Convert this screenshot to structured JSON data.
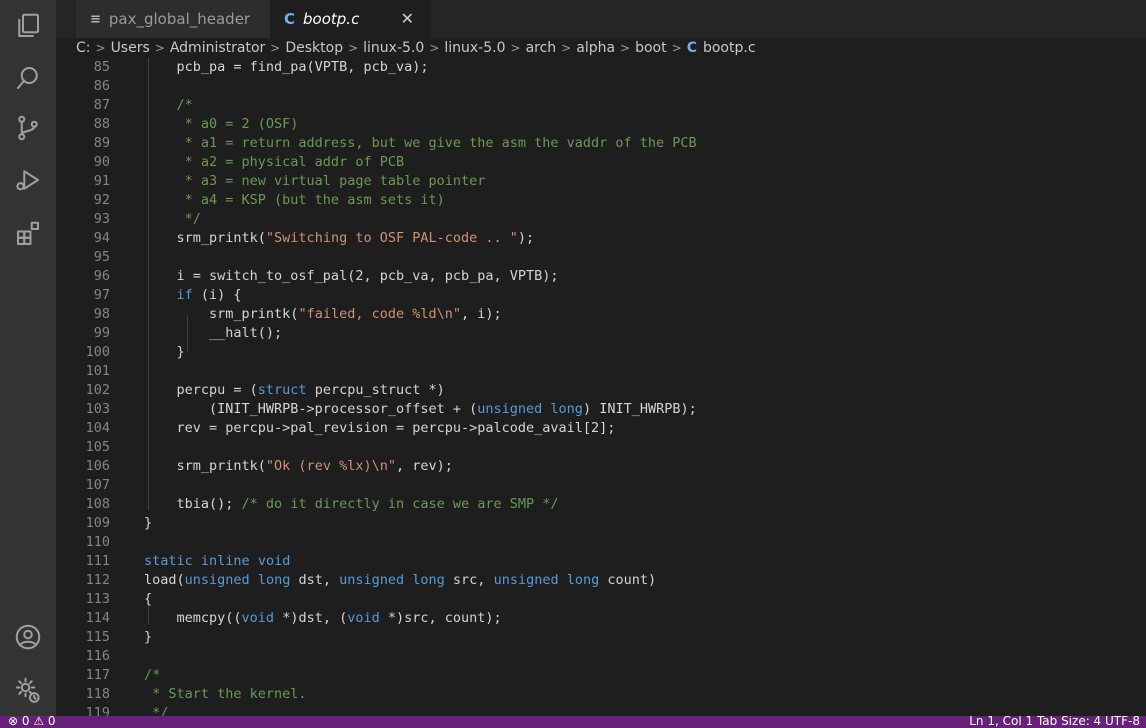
{
  "tabs": [
    {
      "label": "pax_global_header",
      "icon": "lines-icon"
    },
    {
      "label": "bootp.c",
      "icon": "c-icon",
      "close": "✕"
    }
  ],
  "breadcrumb": [
    "C:",
    "Users",
    "Administrator",
    "Desktop",
    "linux-5.0",
    "linux-5.0",
    "arch",
    "alpha",
    "boot",
    "bootp.c"
  ],
  "status": {
    "left": "⊗ 0 ⚠ 0",
    "right": "Ln 1, Col 1   Tab Size: 4   UTF-8"
  },
  "colors": {
    "accent_status": "#68217a",
    "keyword": "#569cd6",
    "string": "#ce9178",
    "comment": "#6a9955"
  },
  "lines": [
    {
      "n": "85",
      "t": "    pcb_pa = find_pa(VPTB, pcb_va);"
    },
    {
      "n": "86",
      "t": ""
    },
    {
      "n": "87",
      "t": "    /*"
    },
    {
      "n": "88",
      "t": "     * a0 = 2 (OSF)"
    },
    {
      "n": "89",
      "t": "     * a1 = return address, but we give the asm the vaddr of the PCB"
    },
    {
      "n": "90",
      "t": "     * a2 = physical addr of PCB"
    },
    {
      "n": "91",
      "t": "     * a3 = new virtual page table pointer"
    },
    {
      "n": "92",
      "t": "     * a4 = KSP (but the asm sets it)"
    },
    {
      "n": "93",
      "t": "     */"
    },
    {
      "n": "94",
      "t": "    srm_printk(\"Switching to OSF PAL-code .. \");"
    },
    {
      "n": "95",
      "t": ""
    },
    {
      "n": "96",
      "t": "    i = switch_to_osf_pal(2, pcb_va, pcb_pa, VPTB);"
    },
    {
      "n": "97",
      "t": "    if (i) {"
    },
    {
      "n": "98",
      "t": "        srm_printk(\"failed, code %ld\\n\", i);"
    },
    {
      "n": "99",
      "t": "        __halt();"
    },
    {
      "n": "100",
      "t": "    }"
    },
    {
      "n": "101",
      "t": ""
    },
    {
      "n": "102",
      "t": "    percpu = (struct percpu_struct *)"
    },
    {
      "n": "103",
      "t": "        (INIT_HWRPB->processor_offset + (unsigned long) INIT_HWRPB);"
    },
    {
      "n": "104",
      "t": "    rev = percpu->pal_revision = percpu->palcode_avail[2];"
    },
    {
      "n": "105",
      "t": ""
    },
    {
      "n": "106",
      "t": "    srm_printk(\"Ok (rev %lx)\\n\", rev);"
    },
    {
      "n": "107",
      "t": ""
    },
    {
      "n": "108",
      "t": "    tbia(); /* do it directly in case we are SMP */"
    },
    {
      "n": "109",
      "t": "}"
    },
    {
      "n": "110",
      "t": ""
    },
    {
      "n": "111",
      "t": "static inline void"
    },
    {
      "n": "112",
      "t": "load(unsigned long dst, unsigned long src, unsigned long count)"
    },
    {
      "n": "113",
      "t": "{"
    },
    {
      "n": "114",
      "t": "    memcpy((void *)dst, (void *)src, count);"
    },
    {
      "n": "115",
      "t": "}"
    },
    {
      "n": "116",
      "t": ""
    },
    {
      "n": "117",
      "t": "/*"
    },
    {
      "n": "118",
      "t": " * Start the kernel."
    },
    {
      "n": "119",
      "t": " */"
    }
  ]
}
